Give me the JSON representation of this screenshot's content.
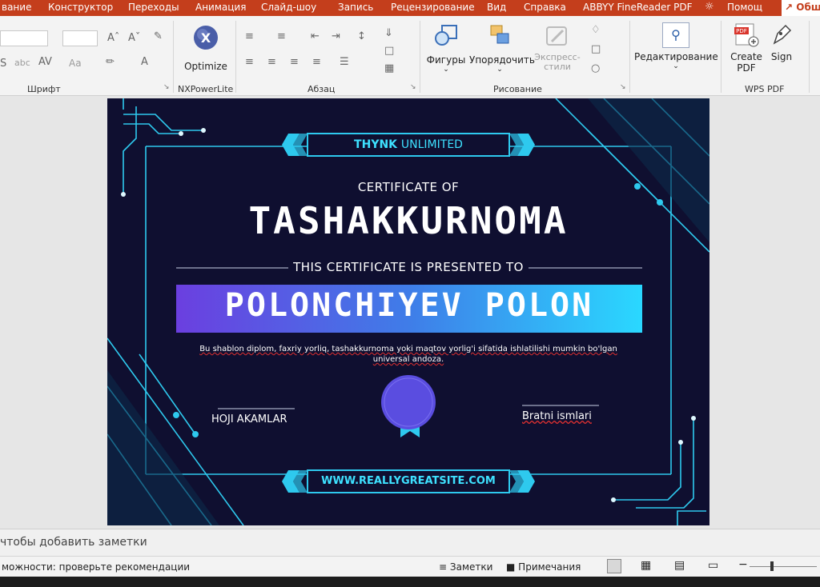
{
  "menu": {
    "items": [
      "вание",
      "Конструктор",
      "Переходы",
      "Анимация",
      "Слайд-шоу",
      "Запись",
      "Рецензирование",
      "Вид",
      "Справка",
      "ABBYY FineReader PDF",
      "Помощ",
      "Общ"
    ]
  },
  "ribbon": {
    "groups": {
      "font": "Шрифт",
      "nxpower": "NXPowerLite",
      "paragraph": "Абзац",
      "drawing": "Рисование",
      "wps": "WPS PDF"
    },
    "buttons": {
      "optimize": "Optimize",
      "shapes": "Фигуры",
      "arrange": "Упорядочить",
      "express_styles_1": "Экспресс-",
      "express_styles_2": "стили",
      "editing": "Редактирование",
      "create_pdf_1": "Create",
      "create_pdf_2": "PDF",
      "sign": "Sign",
      "font_small": "abc",
      "font_aa": "Aa"
    }
  },
  "slide": {
    "brand_bold": "THYNK",
    "brand_light": "UNLIMITED",
    "cert_of": "CERTIFICATE OF",
    "title": "TASHAKKURNOMA",
    "presented": "THIS CERTIFICATE IS PRESENTED TO",
    "name": "POLONCHIYEV POLON",
    "description": "Bu shablon diplom, faxriy yorliq, tashakkurnoma yoki maqtov yorlig'i sifatida ishlatilishi mumkin bo'lgan universal andoza.",
    "signer_left": "HOJI AKAMLAR",
    "signer_right": "Bratni ismlari",
    "website": "WWW.REALLYGREATSITE.COM",
    "colors": {
      "background": "#0f0f30",
      "accent": "#3ee1ff",
      "badge": "#5a4de0"
    }
  },
  "notes": {
    "placeholder": "чтобы добавить заметки"
  },
  "statusbar": {
    "accessibility": "можности: проверьте рекомендации",
    "notes_btn": "Заметки",
    "comments_btn": "Примечания"
  }
}
